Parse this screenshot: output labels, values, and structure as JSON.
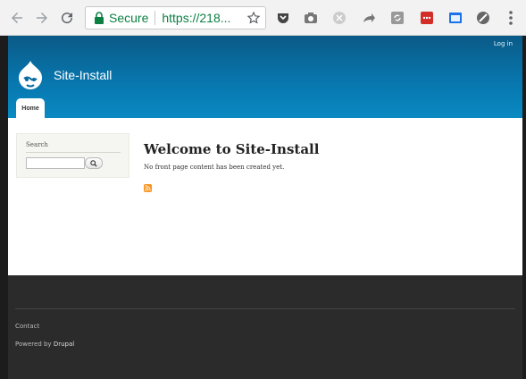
{
  "browser": {
    "secure_label": "Secure",
    "url": "https://218...",
    "extension_icons": [
      "pocket-icon",
      "camera-icon",
      "puzzle-icon",
      "share-icon",
      "sync-icon",
      "lastpass-icon",
      "cast-icon",
      "block-icon"
    ]
  },
  "header": {
    "login_label": "Log in",
    "site_name": "Site-Install",
    "tabs": [
      {
        "label": "Home"
      }
    ],
    "brand_color": "#0876ad"
  },
  "sidebar": {
    "search_title": "Search",
    "search_value": ""
  },
  "main": {
    "title": "Welcome to Site-Install",
    "text": "No front page content has been created yet."
  },
  "footer": {
    "contact_label": "Contact",
    "powered_prefix": "Powered by",
    "powered_link": "Drupal"
  }
}
